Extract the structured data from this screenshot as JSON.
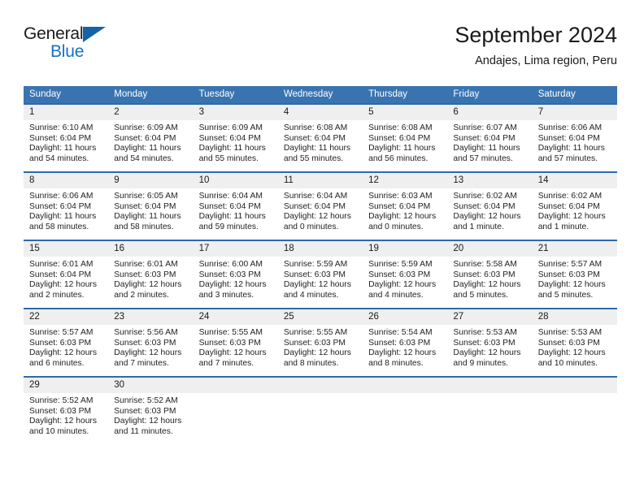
{
  "brand": {
    "name_part1": "General",
    "name_part2": "Blue",
    "logo_icon": "triangle-flag-icon"
  },
  "header": {
    "title": "September 2024",
    "subtitle": "Andajes, Lima region, Peru"
  },
  "calendar": {
    "weekday_headers": [
      "Sunday",
      "Monday",
      "Tuesday",
      "Wednesday",
      "Thursday",
      "Friday",
      "Saturday"
    ],
    "header_bg": "#3a74b0",
    "row_divider": "#2f6aa8",
    "daynum_bg": "#efefef",
    "weeks": [
      [
        {
          "day": "1",
          "sunrise": "Sunrise: 6:10 AM",
          "sunset": "Sunset: 6:04 PM",
          "daylight_line1": "Daylight: 11 hours",
          "daylight_line2": "and 54 minutes."
        },
        {
          "day": "2",
          "sunrise": "Sunrise: 6:09 AM",
          "sunset": "Sunset: 6:04 PM",
          "daylight_line1": "Daylight: 11 hours",
          "daylight_line2": "and 54 minutes."
        },
        {
          "day": "3",
          "sunrise": "Sunrise: 6:09 AM",
          "sunset": "Sunset: 6:04 PM",
          "daylight_line1": "Daylight: 11 hours",
          "daylight_line2": "and 55 minutes."
        },
        {
          "day": "4",
          "sunrise": "Sunrise: 6:08 AM",
          "sunset": "Sunset: 6:04 PM",
          "daylight_line1": "Daylight: 11 hours",
          "daylight_line2": "and 55 minutes."
        },
        {
          "day": "5",
          "sunrise": "Sunrise: 6:08 AM",
          "sunset": "Sunset: 6:04 PM",
          "daylight_line1": "Daylight: 11 hours",
          "daylight_line2": "and 56 minutes."
        },
        {
          "day": "6",
          "sunrise": "Sunrise: 6:07 AM",
          "sunset": "Sunset: 6:04 PM",
          "daylight_line1": "Daylight: 11 hours",
          "daylight_line2": "and 57 minutes."
        },
        {
          "day": "7",
          "sunrise": "Sunrise: 6:06 AM",
          "sunset": "Sunset: 6:04 PM",
          "daylight_line1": "Daylight: 11 hours",
          "daylight_line2": "and 57 minutes."
        }
      ],
      [
        {
          "day": "8",
          "sunrise": "Sunrise: 6:06 AM",
          "sunset": "Sunset: 6:04 PM",
          "daylight_line1": "Daylight: 11 hours",
          "daylight_line2": "and 58 minutes."
        },
        {
          "day": "9",
          "sunrise": "Sunrise: 6:05 AM",
          "sunset": "Sunset: 6:04 PM",
          "daylight_line1": "Daylight: 11 hours",
          "daylight_line2": "and 58 minutes."
        },
        {
          "day": "10",
          "sunrise": "Sunrise: 6:04 AM",
          "sunset": "Sunset: 6:04 PM",
          "daylight_line1": "Daylight: 11 hours",
          "daylight_line2": "and 59 minutes."
        },
        {
          "day": "11",
          "sunrise": "Sunrise: 6:04 AM",
          "sunset": "Sunset: 6:04 PM",
          "daylight_line1": "Daylight: 12 hours",
          "daylight_line2": "and 0 minutes."
        },
        {
          "day": "12",
          "sunrise": "Sunrise: 6:03 AM",
          "sunset": "Sunset: 6:04 PM",
          "daylight_line1": "Daylight: 12 hours",
          "daylight_line2": "and 0 minutes."
        },
        {
          "day": "13",
          "sunrise": "Sunrise: 6:02 AM",
          "sunset": "Sunset: 6:04 PM",
          "daylight_line1": "Daylight: 12 hours",
          "daylight_line2": "and 1 minute."
        },
        {
          "day": "14",
          "sunrise": "Sunrise: 6:02 AM",
          "sunset": "Sunset: 6:04 PM",
          "daylight_line1": "Daylight: 12 hours",
          "daylight_line2": "and 1 minute."
        }
      ],
      [
        {
          "day": "15",
          "sunrise": "Sunrise: 6:01 AM",
          "sunset": "Sunset: 6:04 PM",
          "daylight_line1": "Daylight: 12 hours",
          "daylight_line2": "and 2 minutes."
        },
        {
          "day": "16",
          "sunrise": "Sunrise: 6:01 AM",
          "sunset": "Sunset: 6:03 PM",
          "daylight_line1": "Daylight: 12 hours",
          "daylight_line2": "and 2 minutes."
        },
        {
          "day": "17",
          "sunrise": "Sunrise: 6:00 AM",
          "sunset": "Sunset: 6:03 PM",
          "daylight_line1": "Daylight: 12 hours",
          "daylight_line2": "and 3 minutes."
        },
        {
          "day": "18",
          "sunrise": "Sunrise: 5:59 AM",
          "sunset": "Sunset: 6:03 PM",
          "daylight_line1": "Daylight: 12 hours",
          "daylight_line2": "and 4 minutes."
        },
        {
          "day": "19",
          "sunrise": "Sunrise: 5:59 AM",
          "sunset": "Sunset: 6:03 PM",
          "daylight_line1": "Daylight: 12 hours",
          "daylight_line2": "and 4 minutes."
        },
        {
          "day": "20",
          "sunrise": "Sunrise: 5:58 AM",
          "sunset": "Sunset: 6:03 PM",
          "daylight_line1": "Daylight: 12 hours",
          "daylight_line2": "and 5 minutes."
        },
        {
          "day": "21",
          "sunrise": "Sunrise: 5:57 AM",
          "sunset": "Sunset: 6:03 PM",
          "daylight_line1": "Daylight: 12 hours",
          "daylight_line2": "and 5 minutes."
        }
      ],
      [
        {
          "day": "22",
          "sunrise": "Sunrise: 5:57 AM",
          "sunset": "Sunset: 6:03 PM",
          "daylight_line1": "Daylight: 12 hours",
          "daylight_line2": "and 6 minutes."
        },
        {
          "day": "23",
          "sunrise": "Sunrise: 5:56 AM",
          "sunset": "Sunset: 6:03 PM",
          "daylight_line1": "Daylight: 12 hours",
          "daylight_line2": "and 7 minutes."
        },
        {
          "day": "24",
          "sunrise": "Sunrise: 5:55 AM",
          "sunset": "Sunset: 6:03 PM",
          "daylight_line1": "Daylight: 12 hours",
          "daylight_line2": "and 7 minutes."
        },
        {
          "day": "25",
          "sunrise": "Sunrise: 5:55 AM",
          "sunset": "Sunset: 6:03 PM",
          "daylight_line1": "Daylight: 12 hours",
          "daylight_line2": "and 8 minutes."
        },
        {
          "day": "26",
          "sunrise": "Sunrise: 5:54 AM",
          "sunset": "Sunset: 6:03 PM",
          "daylight_line1": "Daylight: 12 hours",
          "daylight_line2": "and 8 minutes."
        },
        {
          "day": "27",
          "sunrise": "Sunrise: 5:53 AM",
          "sunset": "Sunset: 6:03 PM",
          "daylight_line1": "Daylight: 12 hours",
          "daylight_line2": "and 9 minutes."
        },
        {
          "day": "28",
          "sunrise": "Sunrise: 5:53 AM",
          "sunset": "Sunset: 6:03 PM",
          "daylight_line1": "Daylight: 12 hours",
          "daylight_line2": "and 10 minutes."
        }
      ],
      [
        {
          "day": "29",
          "sunrise": "Sunrise: 5:52 AM",
          "sunset": "Sunset: 6:03 PM",
          "daylight_line1": "Daylight: 12 hours",
          "daylight_line2": "and 10 minutes."
        },
        {
          "day": "30",
          "sunrise": "Sunrise: 5:52 AM",
          "sunset": "Sunset: 6:03 PM",
          "daylight_line1": "Daylight: 12 hours",
          "daylight_line2": "and 11 minutes."
        },
        {
          "day": "",
          "sunrise": "",
          "sunset": "",
          "daylight_line1": "",
          "daylight_line2": ""
        },
        {
          "day": "",
          "sunrise": "",
          "sunset": "",
          "daylight_line1": "",
          "daylight_line2": ""
        },
        {
          "day": "",
          "sunrise": "",
          "sunset": "",
          "daylight_line1": "",
          "daylight_line2": ""
        },
        {
          "day": "",
          "sunrise": "",
          "sunset": "",
          "daylight_line1": "",
          "daylight_line2": ""
        },
        {
          "day": "",
          "sunrise": "",
          "sunset": "",
          "daylight_line1": "",
          "daylight_line2": ""
        }
      ]
    ]
  }
}
